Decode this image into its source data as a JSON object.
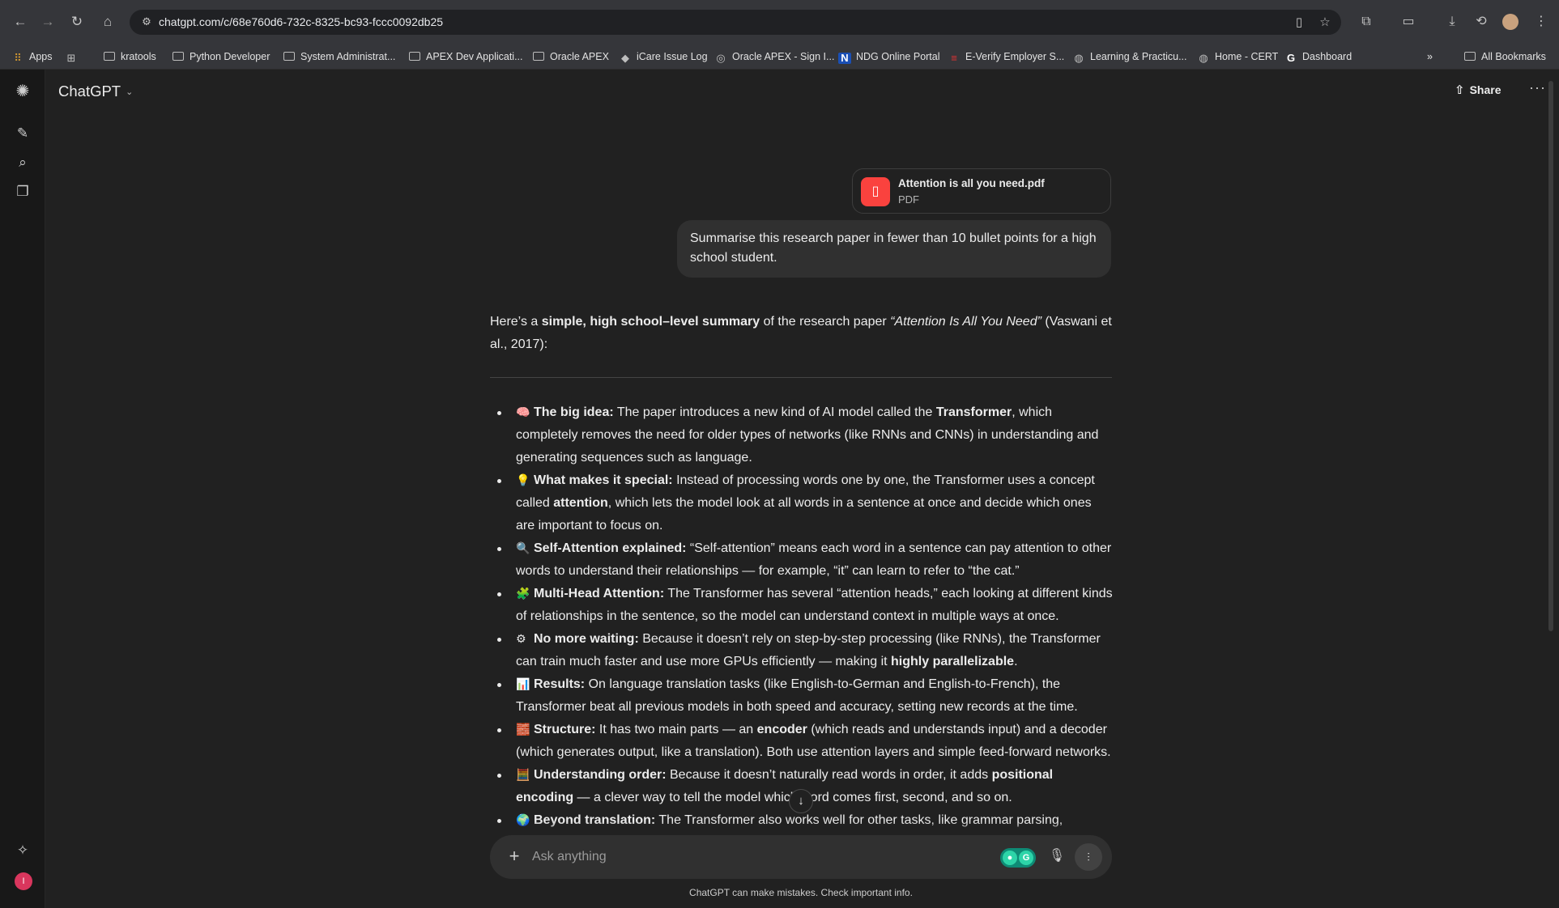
{
  "browser": {
    "url": "chatgpt.com/c/68e760d6-732c-8325-bc93-fccc0092db25",
    "bookmarks": [
      {
        "label": "Apps",
        "icon": "apps-grid-icon"
      },
      {
        "label": "",
        "icon": "grid-icon"
      },
      {
        "label": "kratools",
        "icon": "folder-icon"
      },
      {
        "label": "Python Developer",
        "icon": "folder-icon"
      },
      {
        "label": "System Administrat...",
        "icon": "folder-icon"
      },
      {
        "label": "APEX Dev Applicati...",
        "icon": "folder-icon"
      },
      {
        "label": "Oracle APEX",
        "icon": "folder-icon"
      },
      {
        "label": "iCare Issue Log",
        "icon": "site-icon"
      },
      {
        "label": "Oracle APEX - Sign I...",
        "icon": "site-icon"
      },
      {
        "label": "NDG Online Portal",
        "icon": "site-icon"
      },
      {
        "label": "E-Verify Employer S...",
        "icon": "site-icon"
      },
      {
        "label": "Learning & Practicu...",
        "icon": "site-icon"
      },
      {
        "label": "Home - CERT",
        "icon": "site-icon"
      },
      {
        "label": "Dashboard",
        "icon": "google-icon"
      }
    ],
    "all_bookmarks": "All Bookmarks"
  },
  "app": {
    "title": "ChatGPT",
    "share_label": "Share"
  },
  "attachment": {
    "name": "Attention is all you need.pdf",
    "type": "PDF"
  },
  "user_message": "Summarise this research paper in fewer than 10 bullet points for a high school student.",
  "response": {
    "intro_a": "Here’s a ",
    "intro_bold": "simple, high school–level summary",
    "intro_b": " of the research paper ",
    "intro_italic": "“Attention Is All You Need”",
    "intro_c": " (Vaswani et al., 2017):",
    "bullets": [
      {
        "emoji": "🧠",
        "title": "The big idea:",
        "a": " The paper introduces a new kind of AI model called the ",
        "b": "Transformer",
        "c": ", which completely removes the need for older types of networks (like RNNs and CNNs) in understanding and generating sequences such as language."
      },
      {
        "emoji": "💡",
        "title": "What makes it special:",
        "a": " Instead of processing words one by one, the Transformer uses a concept called ",
        "b": "attention",
        "c": ", which lets the model look at all words in a sentence at once and decide which ones are important to focus on."
      },
      {
        "emoji": "🔍",
        "title": "Self-Attention explained:",
        "a": " “Self-attention” means each word in a sentence can pay attention to other words to understand their relationships — for example, “it” can learn to refer to “the cat.”",
        "b": "",
        "c": ""
      },
      {
        "emoji": "🧩",
        "title": "Multi-Head Attention:",
        "a": " The Transformer has several “attention heads,” each looking at different kinds of relationships in the sentence, so the model can understand context in multiple ways at once.",
        "b": "",
        "c": ""
      },
      {
        "emoji": "⚙",
        "title": "No more waiting:",
        "a": " Because it doesn’t rely on step-by-step processing (like RNNs), the Transformer can train much faster and use more GPUs efficiently — making it ",
        "b": "highly parallelizable",
        "c": "."
      },
      {
        "emoji": "📊",
        "title": "Results:",
        "a": " On language translation tasks (like English-to-German and English-to-French), the Transformer beat all previous models in both speed and accuracy, setting new records at the time.",
        "b": "",
        "c": ""
      },
      {
        "emoji": "🧱",
        "title": "Structure:",
        "a": " It has two main parts — an ",
        "b": "encoder",
        "c": " (which reads and understands input) and a decoder (which generates output, like a translation). Both use attention layers and simple feed-forward networks."
      },
      {
        "emoji": "🧮",
        "title": "Understanding order:",
        "a": " Because it doesn’t naturally read words in order, it adds ",
        "b": "positional encoding",
        "c": " — a clever way to tell the model which word comes first, second, and so on."
      },
      {
        "emoji": "🌍",
        "title": "Beyond translation:",
        "a": " The Transformer also works well for other tasks, like grammar parsing, showing",
        "b": "",
        "c": ""
      }
    ]
  },
  "composer": {
    "placeholder": "Ask anything"
  },
  "footer_note": "ChatGPT can make mistakes. Check important info."
}
